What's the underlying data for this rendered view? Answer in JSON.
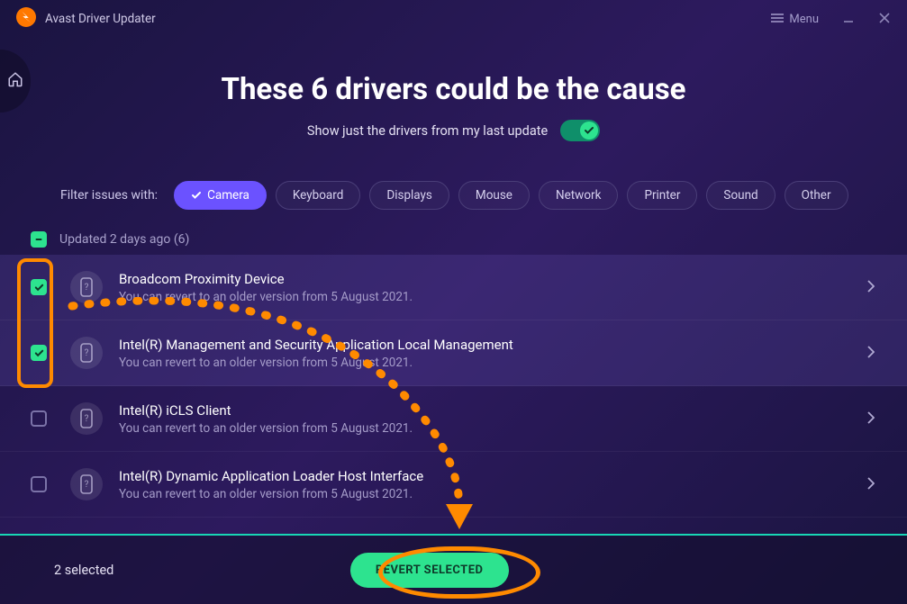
{
  "app": {
    "title": "Avast Driver Updater",
    "menu": "Menu"
  },
  "header": {
    "headline": "These 6 drivers could be the cause",
    "sublabel": "Show just the drivers from my last update",
    "toggle_on": true
  },
  "filters": {
    "label": "Filter issues with:",
    "chips": [
      {
        "name": "camera",
        "label": "Camera",
        "active": true
      },
      {
        "name": "keyboard",
        "label": "Keyboard",
        "active": false
      },
      {
        "name": "displays",
        "label": "Displays",
        "active": false
      },
      {
        "name": "mouse",
        "label": "Mouse",
        "active": false
      },
      {
        "name": "network",
        "label": "Network",
        "active": false
      },
      {
        "name": "printer",
        "label": "Printer",
        "active": false
      },
      {
        "name": "sound",
        "label": "Sound",
        "active": false
      },
      {
        "name": "other",
        "label": "Other",
        "active": false
      }
    ]
  },
  "group": {
    "label": "Updated 2 days ago (6)",
    "state": "indeterminate"
  },
  "drivers": [
    {
      "checked": true,
      "title": "Broadcom Proximity Device",
      "sub": "You can revert to an older version from 5 August 2021."
    },
    {
      "checked": true,
      "title": "Intel(R) Management and Security Application Local Management",
      "sub": "You can revert to an older version from 5 August 2021."
    },
    {
      "checked": false,
      "title": "Intel(R) iCLS Client",
      "sub": "You can revert to an older version from 5 August 2021."
    },
    {
      "checked": false,
      "title": "Intel(R) Dynamic Application Loader Host Interface",
      "sub": "You can revert to an older version from 5 August 2021."
    }
  ],
  "footer": {
    "selected": "2 selected",
    "revert": "REVERT SELECTED"
  }
}
